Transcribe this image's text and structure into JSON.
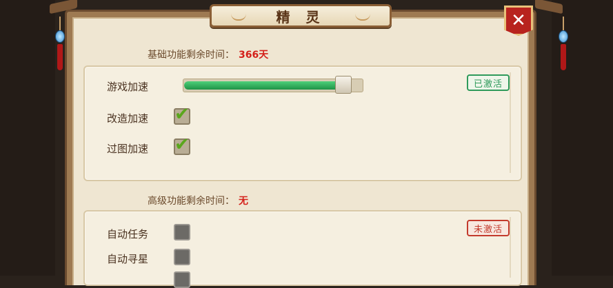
{
  "window": {
    "title": "精 灵",
    "close_label": "✕"
  },
  "basic": {
    "header_label": "基础功能剩余时间：",
    "header_value": "366天",
    "status": "已激活",
    "status_color": "#2e9a5a",
    "speed_label": "游戏加速",
    "speed_level": 0.92,
    "items": [
      {
        "label": "改造加速",
        "checked": true
      },
      {
        "label": "过图加速",
        "checked": true
      }
    ]
  },
  "advanced": {
    "header_label": "高级功能剩余时间：",
    "header_value": "无",
    "status": "未激活",
    "status_color": "#c33a2c",
    "items": [
      {
        "label": "自动任务",
        "checked": false
      },
      {
        "label": "自动寻星",
        "checked": false
      }
    ]
  },
  "colors": {
    "accent_red": "#d4201a",
    "progress_green": "#1f9447",
    "frame_brown": "#6b4b2f"
  },
  "icons": {
    "check": "✔"
  }
}
